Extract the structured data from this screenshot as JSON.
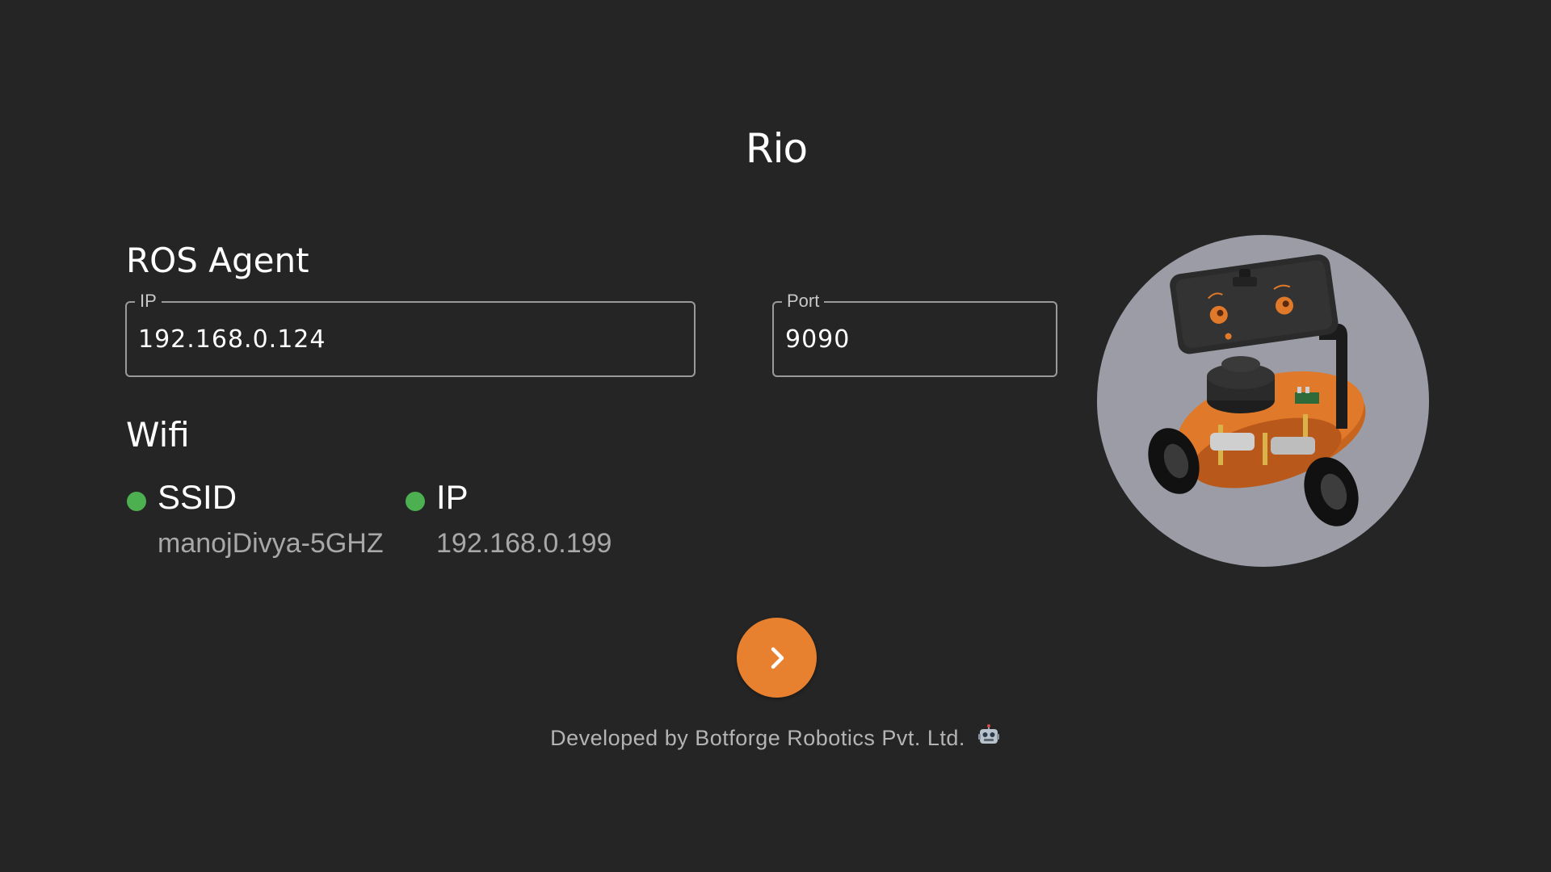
{
  "app": {
    "title": "Rio"
  },
  "ros_agent": {
    "heading": "ROS Agent",
    "ip_field": {
      "label": "IP",
      "value": "192.168.0.124"
    },
    "port_field": {
      "label": "Port",
      "value": "9090"
    }
  },
  "wifi": {
    "heading": "Wifi",
    "ssid": {
      "label": "SSID",
      "value": "manojDivya-5GHZ",
      "status_color": "#4caf50"
    },
    "ip": {
      "label": "IP",
      "value": "192.168.0.199",
      "status_color": "#4caf50"
    }
  },
  "robot_image": {
    "icon": "robot-photo"
  },
  "next_button": {
    "icon": "chevron-right-icon",
    "color": "#e8812f"
  },
  "footer": {
    "text": "Developed by Botforge Robotics Pvt. Ltd.",
    "icon": "robot-emoji-icon"
  },
  "colors": {
    "background": "#252525",
    "accent": "#e8812f",
    "status_ok": "#4caf50"
  }
}
